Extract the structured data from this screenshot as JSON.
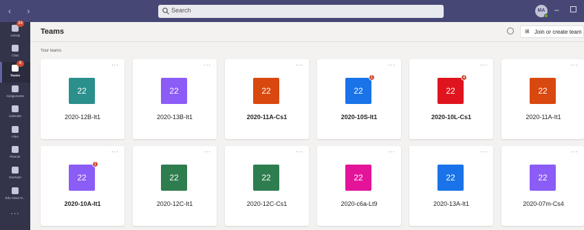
{
  "titlebar": {
    "search_placeholder": "Search",
    "avatar_initials": "MA"
  },
  "rail": {
    "items": [
      {
        "label": "Activity",
        "badge": "34"
      },
      {
        "label": "Chat",
        "badge": ""
      },
      {
        "label": "Teams",
        "badge": "8",
        "active": true
      },
      {
        "label": "Assignments",
        "badge": ""
      },
      {
        "label": "Calendar",
        "badge": ""
      },
      {
        "label": "Files",
        "badge": ""
      },
      {
        "label": "Planner",
        "badge": ""
      },
      {
        "label": "OneNote",
        "badge": ""
      },
      {
        "label": "Edu Class N...",
        "badge": ""
      }
    ],
    "more": "..."
  },
  "header": {
    "title": "Teams",
    "join_button": "Join or create team"
  },
  "section_label": "Your teams",
  "teams": [
    {
      "name": "2020-12B-It1",
      "tile_text": "22",
      "color": "#2b8f8c",
      "bold": false,
      "badge": ""
    },
    {
      "name": "2020-13B-It1",
      "tile_text": "22",
      "color": "#8b5cf6",
      "bold": false,
      "badge": ""
    },
    {
      "name": "2020-11A-Cs1",
      "tile_text": "22",
      "color": "#d9480f",
      "bold": true,
      "badge": ""
    },
    {
      "name": "2020-10S-It1",
      "tile_text": "22",
      "color": "#1a73e8",
      "bold": true,
      "badge": "1"
    },
    {
      "name": "2020-10L-Cs1",
      "tile_text": "22",
      "color": "#e0141e",
      "bold": true,
      "badge": "4"
    },
    {
      "name": "2020-11A-It1",
      "tile_text": "22",
      "color": "#d9480f",
      "bold": false,
      "badge": ""
    },
    {
      "name": "2020-10A-It1",
      "tile_text": "22",
      "color": "#8b5cf6",
      "bold": true,
      "badge": "1"
    },
    {
      "name": "2020-12C-It1",
      "tile_text": "22",
      "color": "#2e7d4f",
      "bold": false,
      "badge": ""
    },
    {
      "name": "2020-12C-Cs1",
      "tile_text": "22",
      "color": "#2e7d4f",
      "bold": false,
      "badge": ""
    },
    {
      "name": "2020-c6a-Lt9",
      "tile_text": "22",
      "color": "#e3149a",
      "bold": false,
      "badge": ""
    },
    {
      "name": "2020-13A-It1",
      "tile_text": "22",
      "color": "#1a73e8",
      "bold": false,
      "badge": ""
    },
    {
      "name": "2020-07m-Cs4",
      "tile_text": "22",
      "color": "#8b5cf6",
      "bold": false,
      "badge": ""
    }
  ]
}
